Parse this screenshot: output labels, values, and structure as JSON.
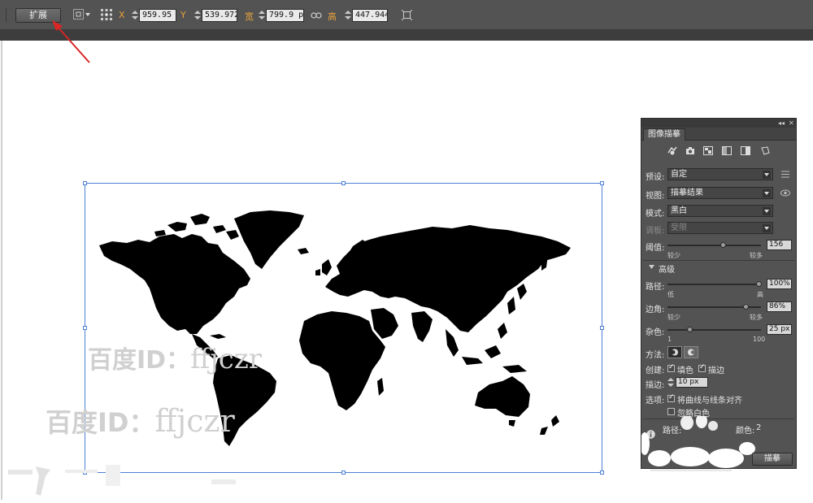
{
  "control_bar": {
    "expand_label": "扩展",
    "x_label": "X",
    "x_value": "959.95 px",
    "y_label": "Y",
    "y_value": "539.972",
    "width_label": "宽",
    "width_value": "799.9 px",
    "height_label": "高",
    "height_value": "447.944"
  },
  "watermarks": [
    {
      "cjk": "百度ID：",
      "latin": "ffjczr"
    },
    {
      "cjk": "百度ID：",
      "latin": "ffjczr"
    }
  ],
  "panel": {
    "tab_title": "图像描摹",
    "preset_label": "预设:",
    "preset_value": "自定",
    "view_label": "视图:",
    "view_value": "描摹结果",
    "mode_label": "模式:",
    "mode_value": "黑白",
    "palette_label": "调板:",
    "palette_value": "受限",
    "threshold_label": "阈值:",
    "threshold_value": "156",
    "threshold_fraction": 0.6,
    "threshold_min": "较少",
    "threshold_max": "较多",
    "advanced_label": "高级",
    "paths_label": "路径:",
    "paths_value": "100%",
    "paths_min": "低",
    "paths_max": "高",
    "corners_label": "边角:",
    "corners_value": "86%",
    "corners_min": "较少",
    "corners_max": "较多",
    "noise_label": "杂色:",
    "noise_value": "25 px",
    "noise_min": "1",
    "noise_max": "100",
    "method_label": "方法:",
    "create_label": "创建:",
    "fill_label": "填色",
    "stroke_label": "描边",
    "stroke_width_label": "描边:",
    "stroke_width_value": "10 px",
    "options_label": "选项:",
    "snap_label": "将曲线与线条对齐",
    "ignore_white_label": "忽略白色",
    "paths_count_label": "路径:",
    "colors_label": "颜色:",
    "colors_value": "2",
    "trace_button_label": "描摹"
  }
}
